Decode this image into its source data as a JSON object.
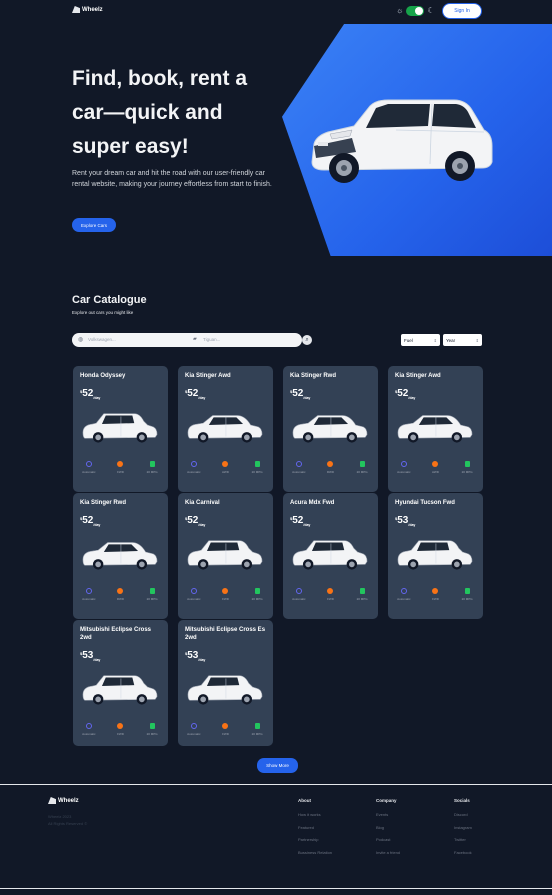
{
  "nav": {
    "brand": "Wheelz",
    "signin_label": "Sign In"
  },
  "hero": {
    "title": "Find, book, rent a car—quick and super easy!",
    "subtitle": "Rent your dream car and hit the road with our user-friendly car rental website, making your journey effortless from start to finish.",
    "cta_label": "Explore Cars"
  },
  "catalogue": {
    "title": "Car Catalogue",
    "subtitle": "Explore out cars you might like",
    "search": {
      "manufacturer_placeholder": "Volkswagen...",
      "model_placeholder": "Tiguan..."
    },
    "filters": {
      "fuel": "Fuel",
      "year": "Year"
    },
    "currency": "$",
    "per_label": "/day",
    "cars": [
      {
        "name": "Honda Odyssey",
        "price": "52",
        "drive": "Automatic",
        "type": "FWD",
        "mpg": "20 MPG"
      },
      {
        "name": "Kia Stinger Awd",
        "price": "52",
        "drive": "Automatic",
        "type": "AWD",
        "mpg": "20 MPG"
      },
      {
        "name": "Kia Stinger Rwd",
        "price": "52",
        "drive": "Automatic",
        "type": "RWD",
        "mpg": "20 MPG"
      },
      {
        "name": "Kia Stinger Awd",
        "price": "52",
        "drive": "Automatic",
        "type": "AWD",
        "mpg": "20 MPG"
      },
      {
        "name": "Kia Stinger Rwd",
        "price": "52",
        "drive": "Automatic",
        "type": "RWD",
        "mpg": "20 MPG"
      },
      {
        "name": "Kia Carnival",
        "price": "52",
        "drive": "Automatic",
        "type": "FWD",
        "mpg": "20 MPG"
      },
      {
        "name": "Acura Mdx Fwd",
        "price": "52",
        "drive": "Automatic",
        "type": "FWD",
        "mpg": "20 MPG"
      },
      {
        "name": "Hyundai Tucson Fwd",
        "price": "53",
        "drive": "Automatic",
        "type": "FWD",
        "mpg": "20 MPG"
      },
      {
        "name": "Mitsubishi Eclipse Cross 2wd",
        "price": "53",
        "drive": "Automatic",
        "type": "FWD",
        "mpg": "20 MPG"
      },
      {
        "name": "Mitsubishi Eclipse Cross Es 2wd",
        "price": "53",
        "drive": "Automatic",
        "type": "FWD",
        "mpg": "20 MPG"
      }
    ],
    "show_more_label": "Show More"
  },
  "footer": {
    "brand": "Wheelz",
    "copyright": "Wheelz 2023",
    "rights": "All Rights Reserved ©",
    "columns": [
      {
        "title": "About",
        "links": [
          "How it works",
          "Featured",
          "Partnership",
          "Bussiness Relation"
        ]
      },
      {
        "title": "Company",
        "links": [
          "Events",
          "Blog",
          "Podcast",
          "Invite a friend"
        ]
      },
      {
        "title": "Socials",
        "links": [
          "Discord",
          "Instagram",
          "Twitter",
          "Facebook"
        ]
      }
    ]
  },
  "colors": {
    "background": "#111827",
    "accent": "#2563eb",
    "card": "#334155",
    "toggle": "#16a34a"
  }
}
